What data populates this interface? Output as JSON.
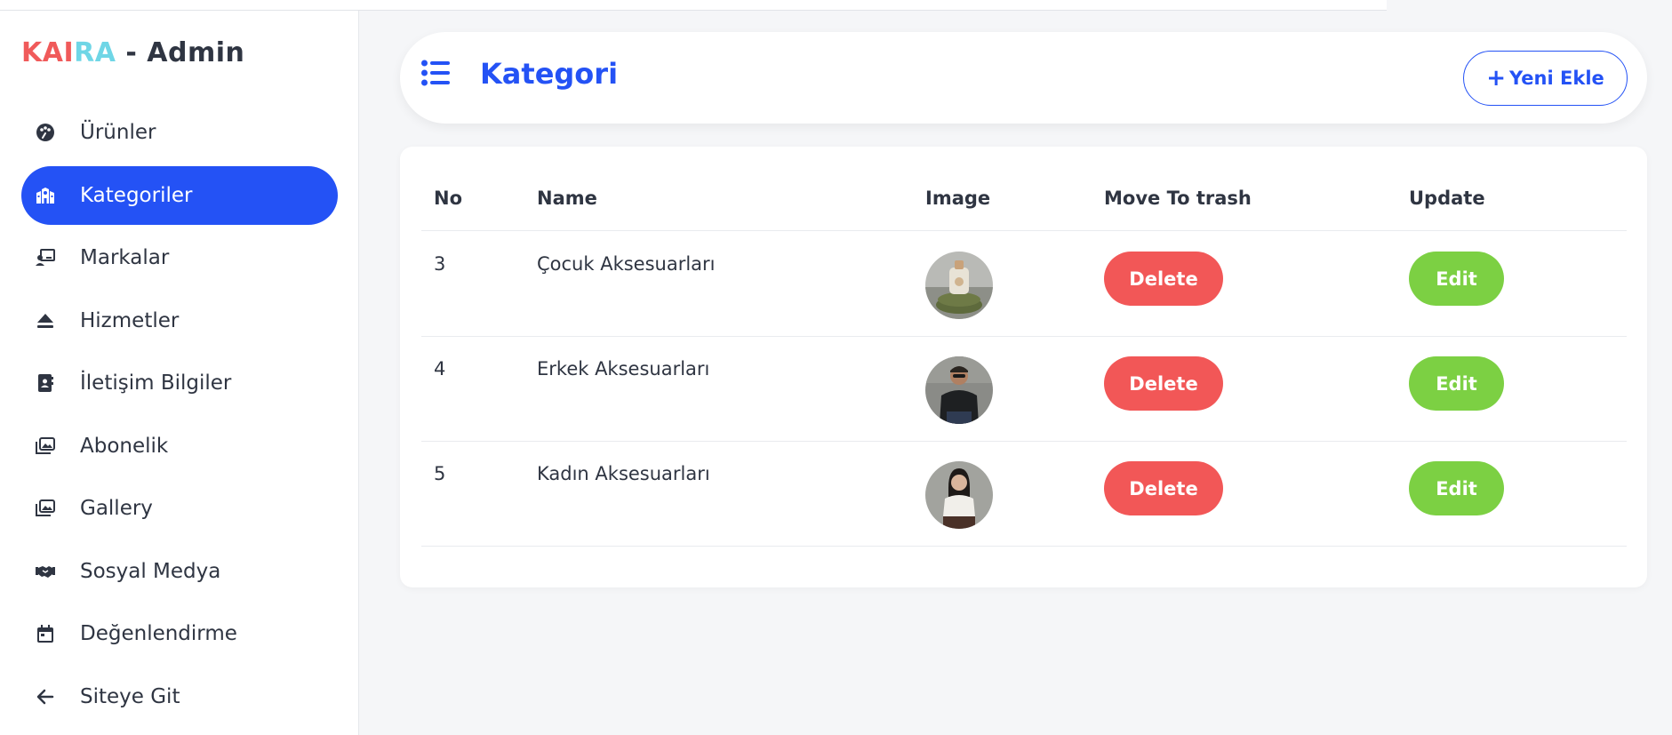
{
  "brand": {
    "k": "KAI",
    "r": "RA",
    "rest": " - Admin"
  },
  "sidebar": {
    "items": [
      {
        "label": "Ürünler",
        "icon": "palette-icon",
        "active": false
      },
      {
        "label": "Kategoriler",
        "icon": "school-building-icon",
        "active": true
      },
      {
        "label": "Markalar",
        "icon": "presentation-user-icon",
        "active": false
      },
      {
        "label": "Hizmetler",
        "icon": "eject-icon",
        "active": false
      },
      {
        "label": "İletişim Bilgiler",
        "icon": "contact-book-icon",
        "active": false
      },
      {
        "label": "Abonelik",
        "icon": "images-icon",
        "active": false
      },
      {
        "label": "Gallery",
        "icon": "images-icon",
        "active": false
      },
      {
        "label": "Sosyal Medya",
        "icon": "handshake-icon",
        "active": false
      },
      {
        "label": "Değenlendirme",
        "icon": "calendar-icon",
        "active": false
      },
      {
        "label": "Siteye Git",
        "icon": "arrow-left-icon",
        "active": false
      }
    ]
  },
  "header": {
    "title": "Kategori",
    "add_label": "Yeni Ekle"
  },
  "table": {
    "columns": {
      "no": "No",
      "name": "Name",
      "image": "Image",
      "trash": "Move To trash",
      "update": "Update"
    },
    "rows": [
      {
        "no": "3",
        "name": "Çocuk Aksesuarları",
        "delete_label": "Delete",
        "edit_label": "Edit"
      },
      {
        "no": "4",
        "name": "Erkek Aksesuarları",
        "delete_label": "Delete",
        "edit_label": "Edit"
      },
      {
        "no": "5",
        "name": "Kadın Aksesuarları",
        "delete_label": "Delete",
        "edit_label": "Edit"
      }
    ]
  },
  "colors": {
    "accent": "#2452f5",
    "danger": "#f25757",
    "success": "#7cd043",
    "brand_k": "#f05a5a",
    "brand_r": "#6fd6e6"
  }
}
